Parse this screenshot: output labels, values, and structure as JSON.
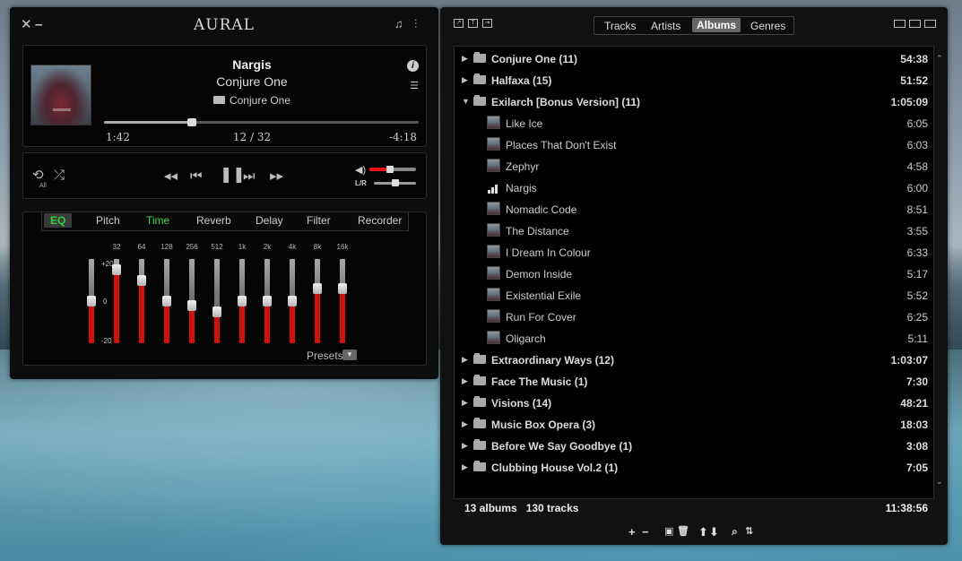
{
  "player": {
    "title": "AURAL",
    "now_playing": {
      "title": "Nargis",
      "artist": "Conjure One",
      "album": "Conjure One",
      "elapsed": "1:42",
      "position": "12 / 32",
      "remaining": "-4:18",
      "progress_fraction": 0.28
    },
    "controls": {
      "repeat_mode": "All",
      "volume_fraction": 0.45,
      "balance_label": "L/R",
      "balance_fraction": 0.5
    },
    "effects": {
      "tabs": [
        "EQ",
        "Pitch",
        "Time",
        "Reverb",
        "Delay",
        "Filter",
        "Recorder"
      ],
      "active_tab": "EQ",
      "scale": {
        "max": "+20",
        "mid": "0",
        "min": "-20"
      },
      "bands": [
        {
          "freq": "",
          "gain_db": 0
        },
        {
          "freq": "32",
          "gain_db": 15
        },
        {
          "freq": "64",
          "gain_db": 10
        },
        {
          "freq": "128",
          "gain_db": 0
        },
        {
          "freq": "256",
          "gain_db": -2
        },
        {
          "freq": "512",
          "gain_db": -5
        },
        {
          "freq": "1k",
          "gain_db": 0
        },
        {
          "freq": "2k",
          "gain_db": 0
        },
        {
          "freq": "4k",
          "gain_db": 0
        },
        {
          "freq": "8k",
          "gain_db": 6
        },
        {
          "freq": "16k",
          "gain_db": 6
        }
      ],
      "presets_label": "Presets"
    }
  },
  "playlist": {
    "view_tabs": [
      "Tracks",
      "Artists",
      "Albums",
      "Genres"
    ],
    "active_view": "Albums",
    "rows": [
      {
        "kind": "album",
        "expanded": false,
        "name": "Conjure One (11)",
        "duration": "54:38"
      },
      {
        "kind": "album",
        "expanded": false,
        "name": "Halfaxa (15)",
        "duration": "51:52"
      },
      {
        "kind": "album",
        "expanded": true,
        "name": "Exilarch [Bonus Version] (11)",
        "duration": "1:05:09"
      },
      {
        "kind": "track",
        "name": "Like Ice",
        "duration": "6:05"
      },
      {
        "kind": "track",
        "name": "Places That Don't Exist",
        "duration": "6:03"
      },
      {
        "kind": "track",
        "name": "Zephyr",
        "duration": "4:58"
      },
      {
        "kind": "track",
        "playing": true,
        "name": "Nargis",
        "duration": "6:00"
      },
      {
        "kind": "track",
        "name": "Nomadic Code",
        "duration": "8:51"
      },
      {
        "kind": "track",
        "name": "The Distance",
        "duration": "3:55"
      },
      {
        "kind": "track",
        "name": "I Dream In Colour",
        "duration": "6:33"
      },
      {
        "kind": "track",
        "name": "Demon Inside",
        "duration": "5:17"
      },
      {
        "kind": "track",
        "name": "Existential Exile",
        "duration": "5:52"
      },
      {
        "kind": "track",
        "name": "Run For Cover",
        "duration": "6:25"
      },
      {
        "kind": "track",
        "name": "Oligarch",
        "duration": "5:11"
      },
      {
        "kind": "album",
        "expanded": false,
        "name": "Extraordinary Ways (12)",
        "duration": "1:03:07"
      },
      {
        "kind": "album",
        "expanded": false,
        "name": "Face The Music (1)",
        "duration": "7:30"
      },
      {
        "kind": "album",
        "expanded": false,
        "name": "Visions (14)",
        "duration": "48:21"
      },
      {
        "kind": "album",
        "expanded": false,
        "name": "Music Box Opera (3)",
        "duration": "18:03"
      },
      {
        "kind": "album",
        "expanded": false,
        "name": "Before We Say Goodbye (1)",
        "duration": "3:08"
      },
      {
        "kind": "album",
        "expanded": false,
        "name": "Clubbing House Vol.2 (1)",
        "duration": "7:05"
      }
    ],
    "summary": {
      "albums": "13 albums",
      "tracks": "130 tracks",
      "total_duration": "11:38:56"
    }
  }
}
